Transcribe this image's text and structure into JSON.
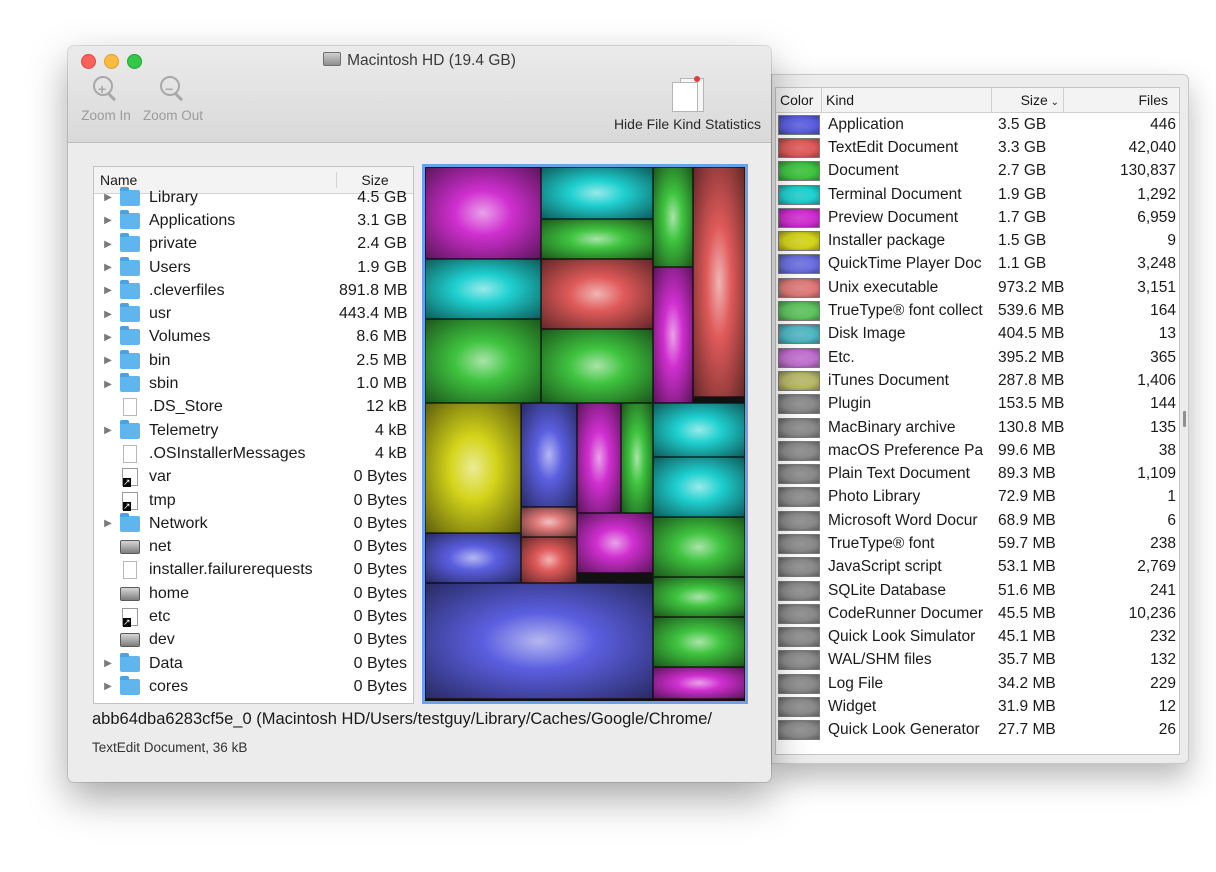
{
  "window": {
    "title": "Macintosh HD (19.4 GB)",
    "toolbar": {
      "zoom_in_label": "Zoom In",
      "zoom_out_label": "Zoom Out",
      "hide_stats_label": "Hide File Kind Statistics"
    }
  },
  "file_list": {
    "headers": {
      "name": "Name",
      "size": "Size"
    },
    "rows": [
      {
        "name": "Library",
        "size": "4.5 GB",
        "icon": "folder-icon",
        "expandable": true
      },
      {
        "name": "Applications",
        "size": "3.1 GB",
        "icon": "folder-icon",
        "expandable": true
      },
      {
        "name": "private",
        "size": "2.4 GB",
        "icon": "folder-icon",
        "expandable": true
      },
      {
        "name": "Users",
        "size": "1.9 GB",
        "icon": "folder-icon",
        "expandable": true
      },
      {
        "name": ".cleverfiles",
        "size": "891.8 MB",
        "icon": "folder-icon",
        "expandable": true
      },
      {
        "name": "usr",
        "size": "443.4 MB",
        "icon": "folder-icon",
        "expandable": true
      },
      {
        "name": "Volumes",
        "size": "8.6 MB",
        "icon": "folder-icon",
        "expandable": true
      },
      {
        "name": "bin",
        "size": "2.5 MB",
        "icon": "folder-icon",
        "expandable": true
      },
      {
        "name": "sbin",
        "size": "1.0 MB",
        "icon": "folder-icon",
        "expandable": true
      },
      {
        "name": ".DS_Store",
        "size": "12 kB",
        "icon": "document-icon",
        "expandable": false
      },
      {
        "name": "Telemetry",
        "size": "4 kB",
        "icon": "folder-icon",
        "expandable": true
      },
      {
        "name": ".OSInstallerMessages",
        "size": "4 kB",
        "icon": "document-icon",
        "expandable": false
      },
      {
        "name": "var",
        "size": "0 Bytes",
        "icon": "alias-icon",
        "expandable": false
      },
      {
        "name": "tmp",
        "size": "0 Bytes",
        "icon": "alias-icon",
        "expandable": false
      },
      {
        "name": "Network",
        "size": "0 Bytes",
        "icon": "folder-icon",
        "expandable": true
      },
      {
        "name": "net",
        "size": "0 Bytes",
        "icon": "drive-icon",
        "expandable": false
      },
      {
        "name": "installer.failurerequests",
        "size": "0 Bytes",
        "icon": "document-icon",
        "expandable": false
      },
      {
        "name": "home",
        "size": "0 Bytes",
        "icon": "drive-icon",
        "expandable": false
      },
      {
        "name": "etc",
        "size": "0 Bytes",
        "icon": "alias-icon",
        "expandable": false
      },
      {
        "name": "dev",
        "size": "0 Bytes",
        "icon": "drive-icon",
        "expandable": false
      },
      {
        "name": "Data",
        "size": "0 Bytes",
        "icon": "folder-icon",
        "expandable": true
      },
      {
        "name": "cores",
        "size": "0 Bytes",
        "icon": "folder-icon",
        "expandable": true
      }
    ]
  },
  "status": {
    "path": "abb64dba6283cf5e_0 (Macintosh HD/Users/testguy/Library/Caches/Google/Chrome/",
    "detail": "TextEdit Document, 36 kB"
  },
  "kind_stats": {
    "headers": {
      "color": "Color",
      "kind": "Kind",
      "size": "Size",
      "files": "Files"
    },
    "rows": [
      {
        "kind": "Application",
        "size": "3.5 GB",
        "files": "446",
        "color": "#5b5fe0"
      },
      {
        "kind": "TextEdit Document",
        "size": "3.3 GB",
        "files": "42,040",
        "color": "#e05a5a"
      },
      {
        "kind": "Document",
        "size": "2.7 GB",
        "files": "130,837",
        "color": "#3fc43f"
      },
      {
        "kind": "Terminal Document",
        "size": "1.9 GB",
        "files": "1,292",
        "color": "#1fd0d0"
      },
      {
        "kind": "Preview Document",
        "size": "1.7 GB",
        "files": "6,959",
        "color": "#d02fd0"
      },
      {
        "kind": "Installer package",
        "size": "1.5 GB",
        "files": "9",
        "color": "#d4d41a"
      },
      {
        "kind": "QuickTime Player Doc",
        "size": "1.1 GB",
        "files": "3,248",
        "color": "#6b6fe0"
      },
      {
        "kind": "Unix executable",
        "size": "973.2 MB",
        "files": "3,151",
        "color": "#e07a7a"
      },
      {
        "kind": "TrueType® font collect",
        "size": "539.6 MB",
        "files": "164",
        "color": "#5fc45f"
      },
      {
        "kind": "Disk Image",
        "size": "404.5 MB",
        "files": "13",
        "color": "#4fb8c4"
      },
      {
        "kind": "Etc.",
        "size": "395.2 MB",
        "files": "365",
        "color": "#c26fd0"
      },
      {
        "kind": "iTunes Document",
        "size": "287.8 MB",
        "files": "1,406",
        "color": "#b8b86a"
      },
      {
        "kind": "Plugin",
        "size": "153.5 MB",
        "files": "144",
        "color": "#8a8a8a"
      },
      {
        "kind": "MacBinary archive",
        "size": "130.8 MB",
        "files": "135",
        "color": "#8a8a8a"
      },
      {
        "kind": "macOS Preference Pa",
        "size": "99.6 MB",
        "files": "38",
        "color": "#8a8a8a"
      },
      {
        "kind": "Plain Text Document",
        "size": "89.3 MB",
        "files": "1,109",
        "color": "#8a8a8a"
      },
      {
        "kind": "Photo Library",
        "size": "72.9 MB",
        "files": "1",
        "color": "#8a8a8a"
      },
      {
        "kind": "Microsoft Word Docur",
        "size": "68.9 MB",
        "files": "6",
        "color": "#8a8a8a"
      },
      {
        "kind": "TrueType® font",
        "size": "59.7 MB",
        "files": "238",
        "color": "#8a8a8a"
      },
      {
        "kind": "JavaScript script",
        "size": "53.1 MB",
        "files": "2,769",
        "color": "#8a8a8a"
      },
      {
        "kind": "SQLite Database",
        "size": "51.6 MB",
        "files": "241",
        "color": "#8a8a8a"
      },
      {
        "kind": "CodeRunner Documer",
        "size": "45.5 MB",
        "files": "10,236",
        "color": "#8a8a8a"
      },
      {
        "kind": "Quick Look Simulator",
        "size": "45.1 MB",
        "files": "232",
        "color": "#8a8a8a"
      },
      {
        "kind": "WAL/SHM files",
        "size": "35.7 MB",
        "files": "132",
        "color": "#8a8a8a"
      },
      {
        "kind": "Log File",
        "size": "34.2 MB",
        "files": "229",
        "color": "#8a8a8a"
      },
      {
        "kind": "Widget",
        "size": "31.9 MB",
        "files": "12",
        "color": "#8a8a8a"
      },
      {
        "kind": "Quick Look Generator",
        "size": "27.7 MB",
        "files": "26",
        "color": "#8a8a8a"
      }
    ]
  }
}
